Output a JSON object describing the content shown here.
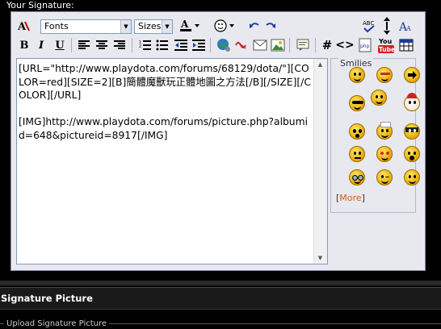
{
  "signature_label": "Your Signature:",
  "toolbar": {
    "font_select": "Fonts",
    "size_select": "Sizes",
    "bold": "B",
    "italic": "I",
    "underline": "U",
    "hash": "#",
    "code": "<>"
  },
  "textarea": {
    "value": "[URL=\"http://www.playdota.com/forums/68129/dota/\"][COLOR=red][SIZE=2][B]簡體魔獸玩正體地圖之方法[/B][/SIZE][/COLOR][/URL]\n\n[IMG]http://www.playdota.com/forums/picture.php?albumid=648&pictureid=8917[/IMG]"
  },
  "smilies": {
    "title": "Smilies",
    "more_bracket_open": "[",
    "more_label": "More",
    "more_bracket_close": "]"
  },
  "signature_picture": {
    "title": "Signature Picture",
    "upload_legend": "Upload Signature Picture"
  },
  "colors": {
    "background": "#000000",
    "editor_bg": "#e8e8ef",
    "more_link": "#d06010"
  }
}
